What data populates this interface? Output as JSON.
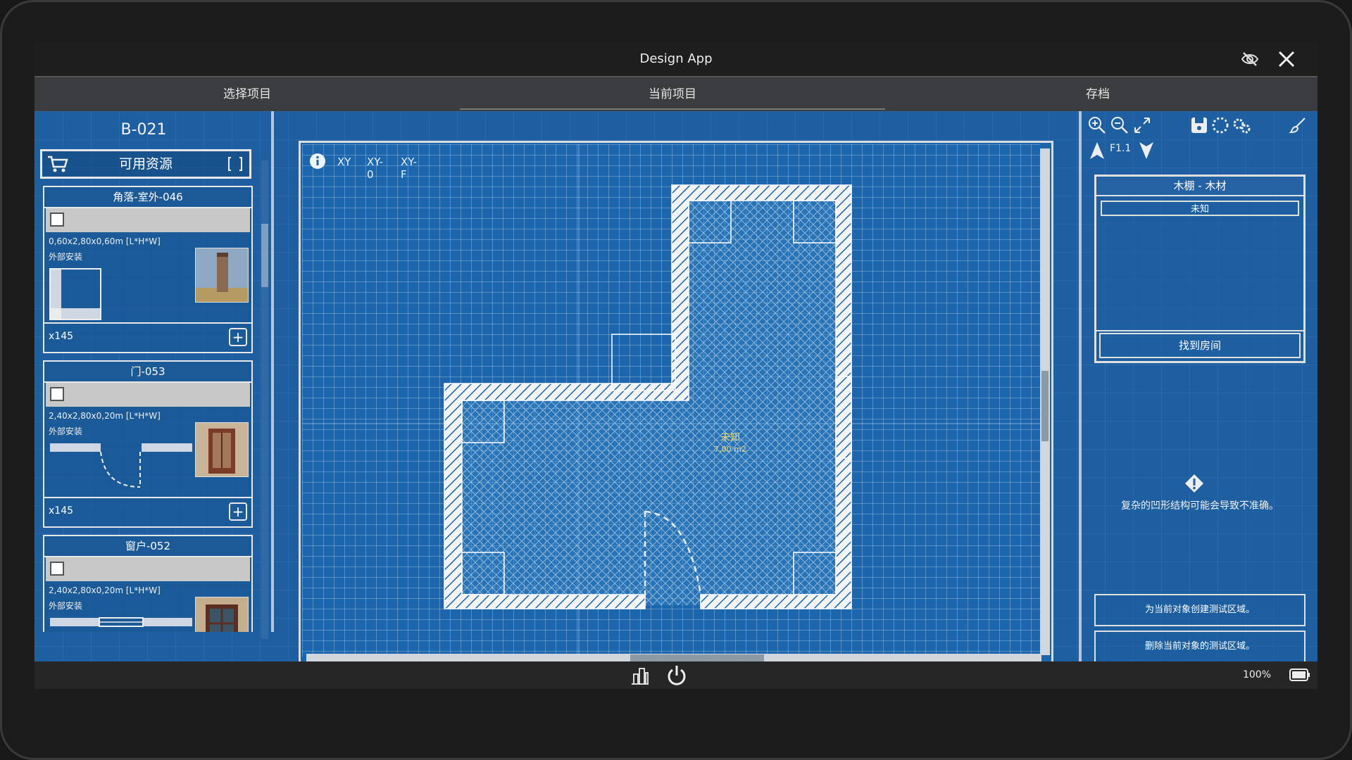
{
  "window": {
    "title": "Design App"
  },
  "tabs": [
    {
      "label": "选择项目"
    },
    {
      "label": "当前项目"
    },
    {
      "label": "存档"
    }
  ],
  "left_panel": {
    "project_code": "B-021",
    "resources_label": "可用资源",
    "items": [
      {
        "title": "角落-室外-046",
        "dims": "0,60x2,80x0,60m [L*H*W]",
        "mount": "外部安装",
        "count": "x145"
      },
      {
        "title": "门-053",
        "dims": "2,40x2,80x0,20m [L*H*W]",
        "mount": "外部安装",
        "count": "x145"
      },
      {
        "title": "窗户-052",
        "dims": "2,40x2,80x0,20m [L*H*W]",
        "mount": "外部安装",
        "count": ""
      }
    ]
  },
  "canvas": {
    "view_modes": [
      "XY",
      "XY-0",
      "XY-F"
    ],
    "room": {
      "name": "未知",
      "area": "7,00 m2"
    }
  },
  "right_panel": {
    "floor": "F1.1",
    "material_title": "木棚 - 木材",
    "material_status": "未知",
    "find_room": "找到房间",
    "warning": "复杂的凹形结构可能会导致不准确。",
    "create_test_area": "为当前对象创建测试区域。",
    "delete_test_area": "删除当前对象的测试区域。"
  },
  "status": {
    "battery": "100%"
  },
  "colors": {
    "blueprint": "#1d5fa0",
    "titlebar": "#1e1e1e",
    "tabbar": "#3a3c3f",
    "room_label": "#f1d46a"
  }
}
